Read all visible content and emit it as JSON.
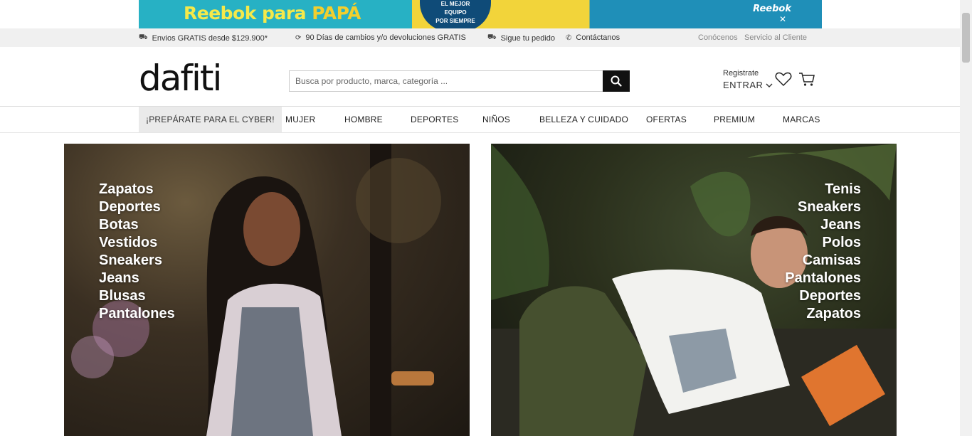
{
  "promo": {
    "title_a": "Reebok para",
    "title_b": "PAPÁ",
    "badge_l1": "EL MEJOR",
    "badge_l2": "EQUIPO",
    "badge_l3": "POR SIEMPRE",
    "brand": "Reebok"
  },
  "util": {
    "shipping": "Envios GRATIS desde $129.900*",
    "returns": "90 Días de cambios y/o devoluciones GRATIS",
    "track": "Sigue tu pedido",
    "contact": "Contáctanos",
    "about": "Conócenos",
    "service": "Servicio al Cliente"
  },
  "header": {
    "logo": "dafiti",
    "search_placeholder": "Busca por producto, marca, categoría ...",
    "register": "Registrate",
    "enter": "ENTRAR"
  },
  "nav": {
    "items": [
      "¡PREPÁRATE PARA EL CYBER!",
      "MUJER",
      "HOMBRE",
      "DEPORTES",
      "NIÑOS",
      "BELLEZA Y CUIDADO",
      "OFERTAS",
      "PREMIUM",
      "MARCAS"
    ]
  },
  "hero_left": {
    "categories": [
      "Zapatos",
      "Deportes",
      "Botas",
      "Vestidos",
      "Sneakers",
      "Jeans",
      "Blusas",
      "Pantalones"
    ]
  },
  "hero_right": {
    "categories": [
      "Tenis",
      "Sneakers",
      "Jeans",
      "Polos",
      "Camisas",
      "Pantalones",
      "Deportes",
      "Zapatos"
    ]
  }
}
